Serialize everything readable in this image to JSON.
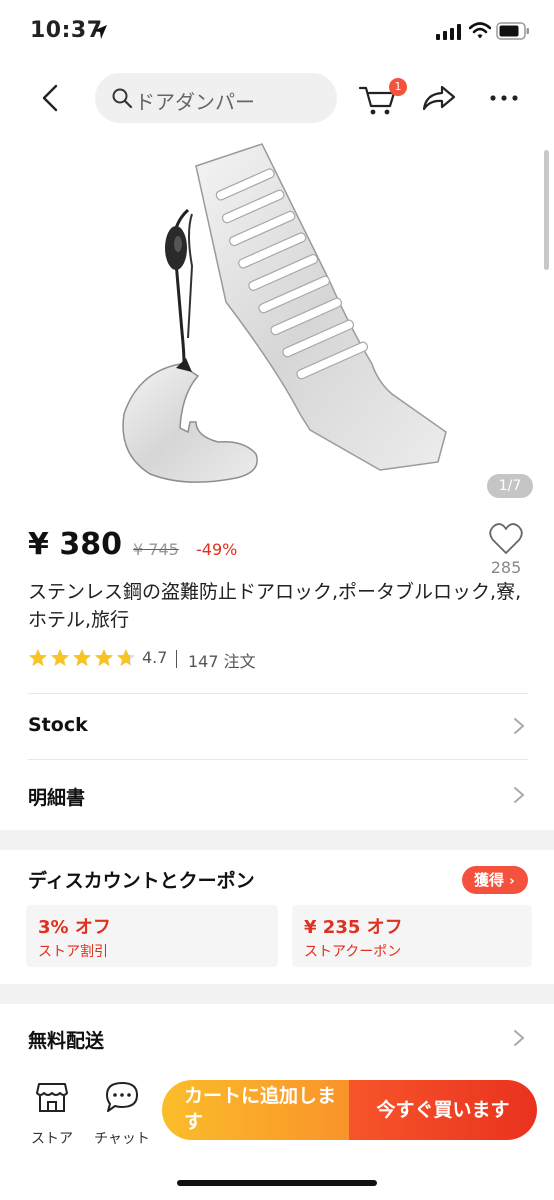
{
  "status_bar": {
    "time": "10:37",
    "icons": [
      "location-arrow-icon",
      "cellular-signal-icon",
      "wifi-icon",
      "battery-icon"
    ]
  },
  "nav": {
    "back_icon": "chevron-left-icon",
    "search_placeholder": "ドアダンパー",
    "cart_icon": "shopping-cart-icon",
    "cart_badge": "1",
    "share_icon": "share-icon",
    "more_icon": "more-icon"
  },
  "product": {
    "image_counter": "1/7",
    "price": "¥ 380",
    "original_price": "¥ 745",
    "discount": "-49%",
    "wishlist_count": "285",
    "title": "ステンレス鋼の盗難防止ドアロック,ポータブルロック,寮,ホテル,旅行",
    "rating": "4.7",
    "rating_stars": 4.7,
    "orders": "147 注文"
  },
  "rows": {
    "stock_label": "Stock",
    "specs_label": "明細書",
    "shipping_label": "無料配送"
  },
  "coupons": {
    "header": "ディスカウントとクーポン",
    "get_label": "獲得",
    "items": [
      {
        "amount": "3% オフ",
        "label": "ストア割引"
      },
      {
        "amount": "¥ 235 オフ",
        "label": "ストアクーポン"
      }
    ]
  },
  "bottom_bar": {
    "store_label": "ストア",
    "chat_label": "チャット",
    "add_to_cart": "カートに追加します",
    "buy_now": "今すぐ買います"
  },
  "colors": {
    "accent_red": "#e0301e",
    "badge_red": "#f5523d",
    "star_yellow": "#f7c325",
    "cart_orange": "#f9932a"
  }
}
